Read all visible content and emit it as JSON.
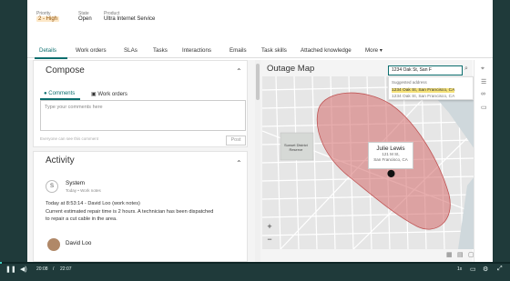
{
  "header": {
    "priority_label": "Priority",
    "priority_value": "2 - High",
    "state_label": "State",
    "state_value": "Open",
    "product_label": "Product",
    "product_value": "Ultra Internet Service"
  },
  "tabs": [
    "Details",
    "Work orders",
    "SLAs",
    "Tasks",
    "Interactions",
    "Emails",
    "Task skills",
    "Attached knowledge",
    "More"
  ],
  "compose": {
    "title": "Compose",
    "tab_comments": "Comments",
    "tab_work_orders": "Work orders",
    "placeholder": "Type your comments here",
    "note": "Everyone can see this comment",
    "post": "Post"
  },
  "activity": {
    "title": "Activity",
    "entry1_initial": "S",
    "entry1_name": "System",
    "entry1_sub": "Today • Work notes",
    "entry1_line1": "Today at 8:53:14 - David Loo (work notes)",
    "entry1_line2": "Current estimated repair time is 2 hours. A technician has been dispatched",
    "entry1_line3": "to repair a cut cable in the area.",
    "entry2_name": "David Loo"
  },
  "map": {
    "title": "Outage Map",
    "search_value": "1234 Oak St, San F",
    "suggest_header": "Suggested address",
    "suggest_item": "1234 Oak St, San Francisco, CA",
    "suggest_item2": "1234 Oak St, San Francisco, CA",
    "popup_name": "Julie Lewis",
    "popup_line1": "121 M St,",
    "popup_line2": "San Francisco, CA",
    "district_label": "Sunset District",
    "district_label_line2": "Reserve"
  },
  "player": {
    "time_current": "20:08",
    "time_sep": "/",
    "time_total": "22:07",
    "speed": "1x"
  },
  "colors": {
    "accent": "#0b6e6e",
    "outage": "#d46a6a",
    "sidebar": "#1f3a3a"
  }
}
